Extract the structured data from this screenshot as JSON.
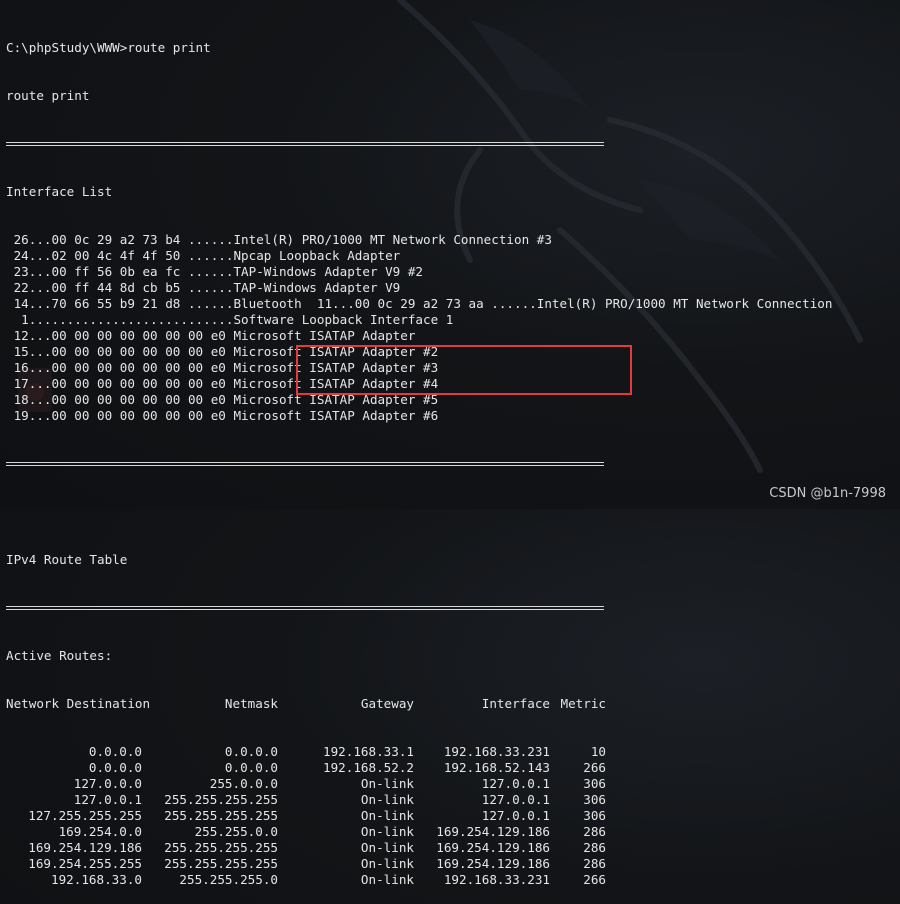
{
  "prompt": "C:\\phpStudy\\WWW>route print",
  "echo": "route print",
  "interface_list": {
    "title": "Interface List",
    "items": [
      " 26...00 0c 29 a2 73 b4 ......Intel(R) PRO/1000 MT Network Connection #3",
      " 24...02 00 4c 4f 4f 50 ......Npcap Loopback Adapter",
      " 23...00 ff 56 0b ea fc ......TAP-Windows Adapter V9 #2",
      " 22...00 ff 44 8d cb b5 ......TAP-Windows Adapter V9",
      " 14...70 66 55 b9 21 d8 ......Bluetooth  11...00 0c 29 a2 73 aa ......Intel(R) PRO/1000 MT Network Connection",
      "  1...........................Software Loopback Interface 1",
      " 12...00 00 00 00 00 00 00 e0 Microsoft ISATAP Adapter",
      " 15...00 00 00 00 00 00 00 e0 Microsoft ISATAP Adapter #2",
      " 16...00 00 00 00 00 00 00 e0 Microsoft ISATAP Adapter #3",
      " 17...00 00 00 00 00 00 00 e0 Microsoft ISATAP Adapter #4",
      " 18...00 00 00 00 00 00 00 e0 Microsoft ISATAP Adapter #5",
      " 19...00 00 00 00 00 00 00 e0 Microsoft ISATAP Adapter #6"
    ]
  },
  "ipv4_title": "IPv4 Route Table",
  "active_routes": {
    "title": "Active Routes:",
    "headers": {
      "destination": "Network Destination",
      "netmask": "Netmask",
      "gateway": "Gateway",
      "interface": "Interface",
      "metric": "Metric"
    },
    "rows": [
      {
        "destination": "0.0.0.0",
        "netmask": "0.0.0.0",
        "gateway": "192.168.33.1",
        "interface": "192.168.33.231",
        "metric": "10"
      },
      {
        "destination": "0.0.0.0",
        "netmask": "0.0.0.0",
        "gateway": "192.168.52.2",
        "interface": "192.168.52.143",
        "metric": "266"
      },
      {
        "destination": "127.0.0.0",
        "netmask": "255.0.0.0",
        "gateway": "On-link",
        "interface": "127.0.0.1",
        "metric": "306"
      },
      {
        "destination": "127.0.0.1",
        "netmask": "255.255.255.255",
        "gateway": "On-link",
        "interface": "127.0.0.1",
        "metric": "306"
      },
      {
        "destination": "127.255.255.255",
        "netmask": "255.255.255.255",
        "gateway": "On-link",
        "interface": "127.0.0.1",
        "metric": "306"
      },
      {
        "destination": "169.254.0.0",
        "netmask": "255.255.0.0",
        "gateway": "On-link",
        "interface": "169.254.129.186",
        "metric": "286"
      },
      {
        "destination": "169.254.129.186",
        "netmask": "255.255.255.255",
        "gateway": "On-link",
        "interface": "169.254.129.186",
        "metric": "286"
      },
      {
        "destination": "169.254.255.255",
        "netmask": "255.255.255.255",
        "gateway": "On-link",
        "interface": "169.254.129.186",
        "metric": "286"
      },
      {
        "destination": "192.168.33.0",
        "netmask": "255.255.255.0",
        "gateway": "On-link",
        "interface": "192.168.33.231",
        "metric": "266"
      }
    ]
  },
  "watermark": "CSDN @b1n-7998",
  "colors": {
    "background": "#121417",
    "text": "#e6e6e6",
    "highlight": "#e23b3f"
  }
}
